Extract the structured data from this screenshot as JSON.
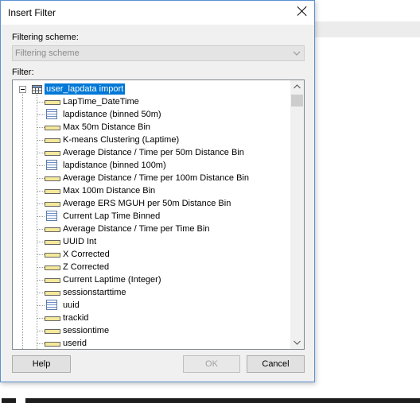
{
  "dialog": {
    "title": "Insert Filter",
    "scheme_label": "Filtering scheme:",
    "scheme_value": "Filtering scheme",
    "filter_label": "Filter:"
  },
  "tree": {
    "root": "user_lapdata import",
    "items": [
      {
        "label": "LapTime_DateTime",
        "icon": "numeric-column-icon"
      },
      {
        "label": "lapdistance (binned 50m)",
        "icon": "binned-column-icon"
      },
      {
        "label": "Max 50m Distance Bin",
        "icon": "numeric-column-icon"
      },
      {
        "label": "K-means Clustering (Laptime)",
        "icon": "numeric-column-icon"
      },
      {
        "label": "Average Distance / Time per 50m Distance Bin",
        "icon": "numeric-column-icon"
      },
      {
        "label": "lapdistance (binned 100m)",
        "icon": "binned-column-icon"
      },
      {
        "label": "Average Distance / Time per 100m Distance Bin",
        "icon": "numeric-column-icon"
      },
      {
        "label": "Max 100m Distance Bin",
        "icon": "numeric-column-icon"
      },
      {
        "label": "Average ERS MGUH per 50m Distance Bin",
        "icon": "numeric-column-icon"
      },
      {
        "label": "Current Lap Time Binned",
        "icon": "binned-column-icon"
      },
      {
        "label": "Average Distance / Time per Time Bin",
        "icon": "numeric-column-icon"
      },
      {
        "label": "UUID Int",
        "icon": "numeric-column-icon"
      },
      {
        "label": "X Corrected",
        "icon": "numeric-column-icon"
      },
      {
        "label": "Z Corrected",
        "icon": "numeric-column-icon"
      },
      {
        "label": "Current Laptime (Integer)",
        "icon": "numeric-column-icon"
      },
      {
        "label": "sessionstarttime",
        "icon": "numeric-column-icon"
      },
      {
        "label": "uuid",
        "icon": "binned-column-icon"
      },
      {
        "label": "trackid",
        "icon": "numeric-column-icon"
      },
      {
        "label": "sessiontime",
        "icon": "numeric-column-icon"
      },
      {
        "label": "userid",
        "icon": "numeric-column-icon"
      }
    ]
  },
  "buttons": {
    "help": "Help",
    "ok": "OK",
    "cancel": "Cancel"
  },
  "colors": {
    "selection": "#0078d7",
    "dialog_border": "#5a91d1"
  }
}
